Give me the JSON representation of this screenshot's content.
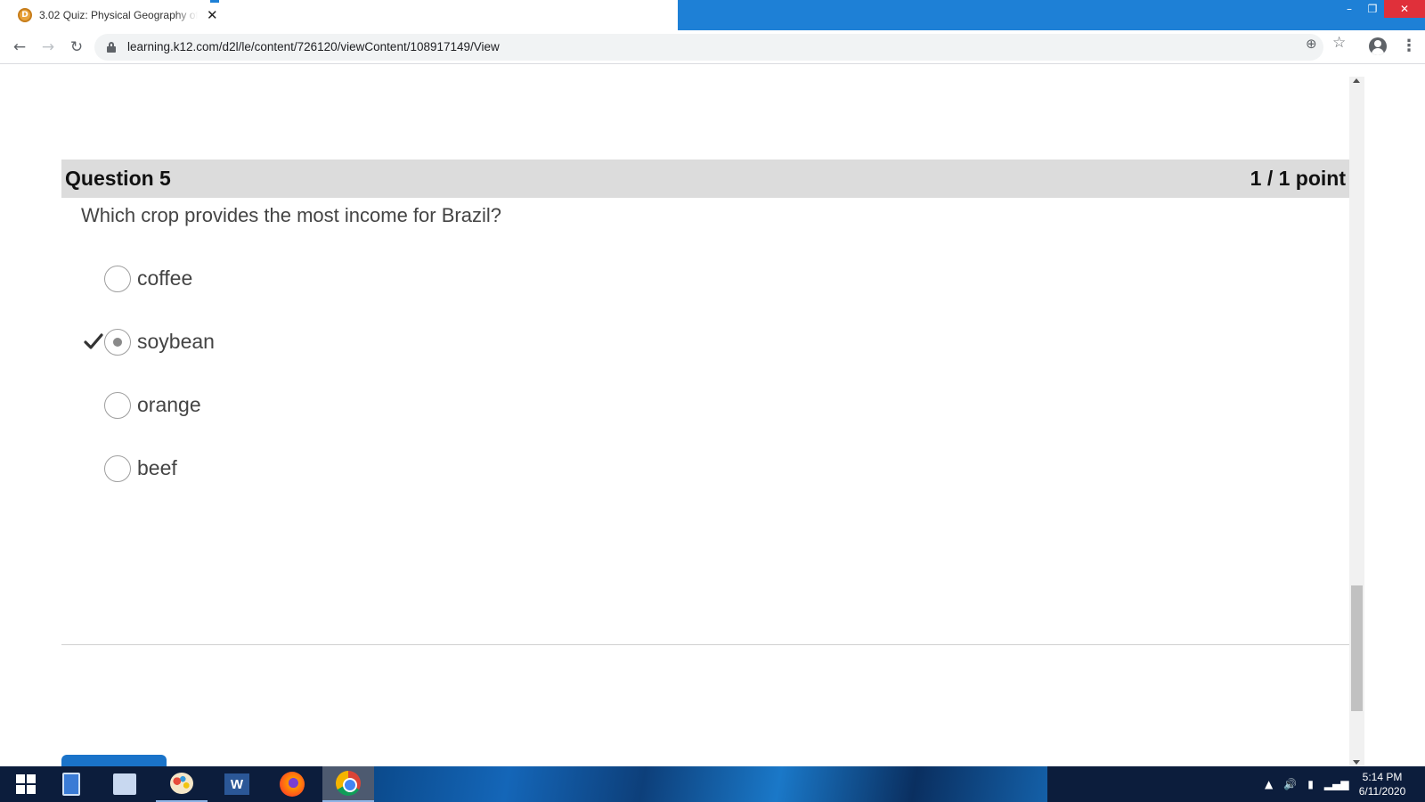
{
  "browser": {
    "tab_title": "3.02 Quiz: Physical Geography of",
    "tab_close": "✕",
    "favicon_letter": "D",
    "url": "learning.k12.com/d2l/le/content/726120/viewContent/108917149/View",
    "window_controls": {
      "minimize": "–",
      "maximize": "❐",
      "close": "✕"
    },
    "nav": {
      "back": "←",
      "forward": "→",
      "reload": "↻"
    },
    "zoom_icon": "⊕",
    "star_icon": "☆",
    "menu_icon": "⋮"
  },
  "quiz": {
    "question_title": "Question 5",
    "points": "1 / 1 point",
    "question_text": "Which crop provides the most income for Brazil?",
    "options": [
      {
        "label": "coffee",
        "selected": false,
        "correct_mark": false
      },
      {
        "label": "soybean",
        "selected": true,
        "correct_mark": true
      },
      {
        "label": "orange",
        "selected": false,
        "correct_mark": false
      },
      {
        "label": "beef",
        "selected": false,
        "correct_mark": false
      }
    ]
  },
  "taskbar": {
    "apps": [
      "start",
      "calculator",
      "snipping-tool",
      "paint",
      "word",
      "firefox",
      "chrome"
    ],
    "word_letter": "W",
    "tray_symbols": {
      "arrow": "▲",
      "volume": "🔊",
      "battery": "▮",
      "signal": "▂▄▆"
    },
    "time": "5:14 PM",
    "date": "6/11/2020"
  },
  "colors": {
    "taskbar": "#0c1d3c",
    "tab_strip": "#1e80d6",
    "question_header": "#dcdcdc",
    "next_button": "#1a73c9"
  }
}
